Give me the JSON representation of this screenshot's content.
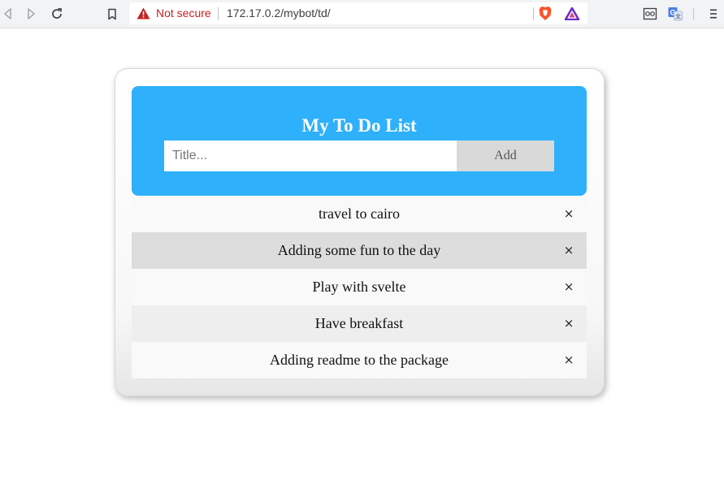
{
  "browser": {
    "security_label": "Not secure",
    "url": "172.17.0.2/mybot/td/",
    "colors": {
      "warning": "#c5221f",
      "brave": "#fb542b",
      "rewards": "#6b2ec4"
    },
    "icons": {
      "back": "back-arrow-icon",
      "forward": "forward-arrow-icon",
      "reload": "reload-icon",
      "bookmark": "bookmark-icon",
      "warning": "warning-triangle-icon",
      "brave_shields": "brave-shields-icon",
      "rewards": "brave-rewards-icon",
      "reader": "reader-mode-icon",
      "translate": "translate-icon",
      "menu": "menu-icon"
    }
  },
  "todo": {
    "title": "My To Do List",
    "input": {
      "placeholder": "Title...",
      "value": ""
    },
    "add_label": "Add",
    "close_symbol": "×",
    "colors": {
      "header": "#2eb0fb",
      "header_text": "#ffffff",
      "add_button": "#d9d9d9"
    },
    "items": [
      {
        "text": "travel to cairo",
        "background": "#f9f9f9"
      },
      {
        "text": "Adding some fun to the day",
        "background": "#dddddd"
      },
      {
        "text": "Play with svelte",
        "background": "#f9f9f9"
      },
      {
        "text": "Have breakfast",
        "background": "#eeeeee"
      },
      {
        "text": "Adding readme to the package",
        "background": "#f9f9f9"
      }
    ]
  }
}
